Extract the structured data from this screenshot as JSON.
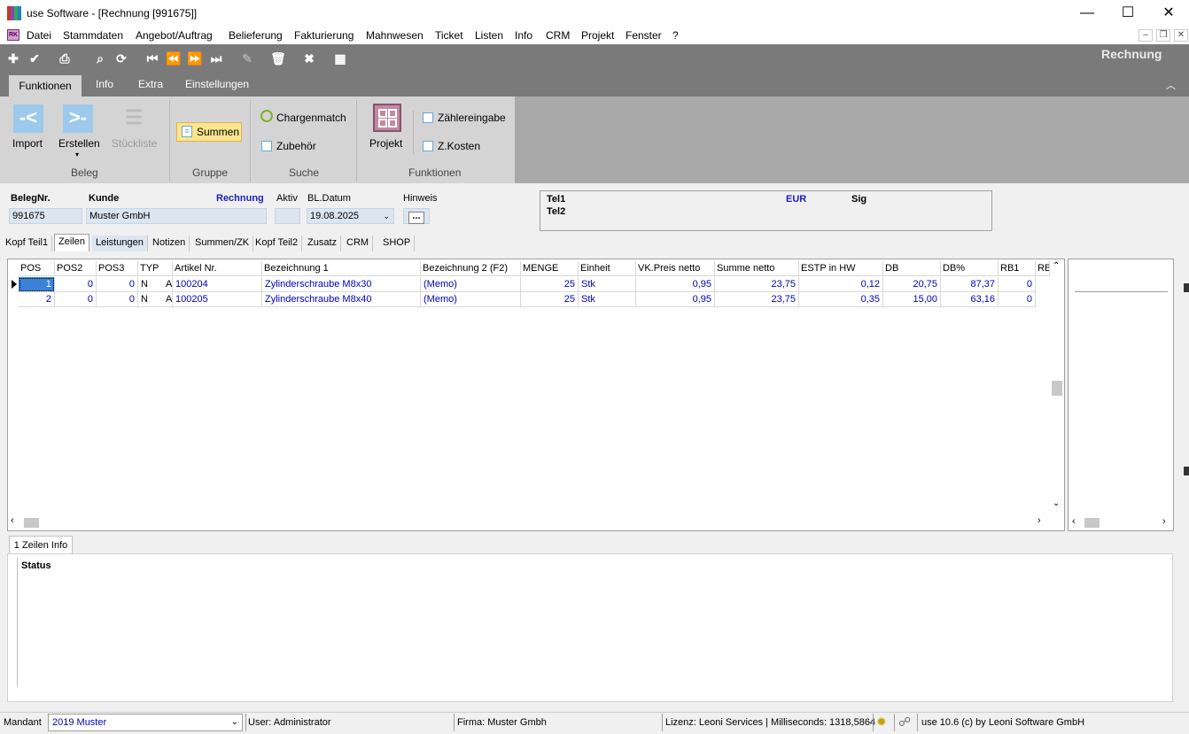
{
  "window": {
    "title": "use Software - [Rechnung [991675]]",
    "minimize": "—",
    "maximize": "☐",
    "close": "✕"
  },
  "menu": {
    "doc_icon": "RK",
    "items": [
      "Datei",
      "Stammdaten",
      "Angebot/Auftrag",
      "Belieferung",
      "Fakturierung",
      "Mahnwesen",
      "Ticket",
      "Listen",
      "Info",
      "CRM",
      "Projekt",
      "Fenster",
      "?"
    ],
    "mdi_min": "–",
    "mdi_restore": "❐",
    "mdi_close": "✕"
  },
  "toolbar": {
    "doc_type": "Rechnung",
    "icons": [
      "add-icon",
      "check-icon",
      "print-icon",
      "search-icon",
      "refresh-icon",
      "first-icon",
      "prev-icon",
      "next-icon",
      "last-icon",
      "edit-icon",
      "delete-icon",
      "cancel-icon",
      "grid-icon"
    ]
  },
  "ribbon": {
    "tabs": [
      "Funktionen",
      "Info",
      "Extra",
      "Einstellungen"
    ],
    "groups": {
      "beleg": {
        "label": "Beleg",
        "import": "Import",
        "erstellen": "Erstellen",
        "stueckliste": "Stückliste"
      },
      "gruppe": {
        "label": "Gruppe",
        "summen": "Summen"
      },
      "suche": {
        "label": "Suche",
        "chargenmatch": "Chargenmatch",
        "zubehoer": "Zubehör"
      },
      "funktionen": {
        "label": "Funktionen",
        "projekt": "Projekt",
        "zaehlereingabe": "Zählereingabe",
        "zkosten": "Z.Kosten"
      }
    }
  },
  "header": {
    "belegnr_label": "BelegNr.",
    "belegnr": "991675",
    "kunde_label": "Kunde",
    "kunde": "Muster GmbH",
    "doc_type": "Rechnung",
    "aktiv_label": "Aktiv",
    "bldatum_label": "BL.Datum",
    "bldatum": "19.08.2025",
    "hinweis_label": "Hinweis",
    "hinweis_btn": "...",
    "info": {
      "tel1": "Tel1",
      "tel2": "Tel2",
      "currency": "EUR",
      "sig": "Sig"
    }
  },
  "doc_tabs": [
    "Kopf Teil1",
    "Zeilen",
    "Leistungen",
    "Notizen",
    "Summen/ZK",
    "Kopf Teil2",
    "Zusatz",
    "CRM",
    "SHOP"
  ],
  "grid": {
    "columns": [
      "POS",
      "POS2",
      "POS3",
      "TYP",
      "Artikel Nr.",
      "Bezeichnung 1",
      "Bezeichnung 2 (F2)",
      "MENGE",
      "Einheit",
      "VK.Preis netto",
      "Summe netto",
      "ESTP in HW",
      "DB",
      "DB%",
      "RB1",
      "RB"
    ],
    "rows": [
      [
        "1",
        "0",
        "0",
        "N",
        "A",
        "100204",
        "Zylinderschraube M8x30",
        "(Memo)",
        "25",
        "Stk",
        "0,95",
        "23,75",
        "0,12",
        "20,75",
        "87,37",
        "0"
      ],
      [
        "2",
        "0",
        "0",
        "N",
        "A",
        "100205",
        "Zylinderschraube M8x40",
        "(Memo)",
        "25",
        "Stk",
        "0,95",
        "23,75",
        "0,35",
        "15,00",
        "63,16",
        "0"
      ]
    ]
  },
  "info_panel": {
    "tab": "1 Zeilen Info",
    "status_label": "Status"
  },
  "statusbar": {
    "mandant_label": "Mandant",
    "mandant": "2019 Muster",
    "user": "User: Administrator",
    "firma": "Firma: Muster Gmbh",
    "lizenz": "Lizenz: Leoni Services | Milliseconds: 1318,5864",
    "version": "use 10.6 (c) by Leoni Software GmbH"
  }
}
